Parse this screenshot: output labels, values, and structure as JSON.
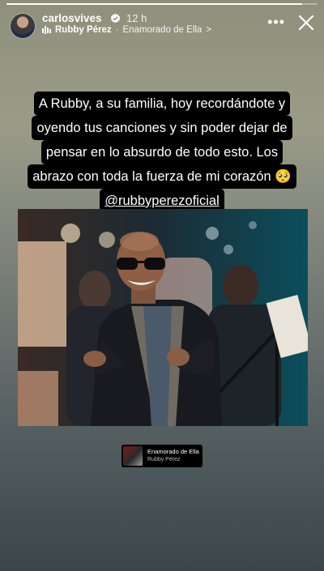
{
  "progress": {
    "fraction": 0.95
  },
  "header": {
    "username": "carlosvives",
    "time": "12 h",
    "music": {
      "artist": "Rubby Pérez",
      "separator": "·",
      "song": "Enamorado de Ella",
      "chevron": ">"
    },
    "icons": {
      "avatar": "avatar",
      "verified": "verified-badge-icon",
      "music": "music-bars-icon",
      "more": "more-icon",
      "close": "close-icon"
    }
  },
  "caption": {
    "lines": [
      "A Rubby, a su familia, hoy recordándote y",
      "oyendo tus canciones y sin poder dejar de",
      "pensar en lo absurdo de todo esto. Los",
      "abrazo con toda la fuerza de mi corazón 🥺"
    ],
    "mention": "@rubbyperezoficial"
  },
  "sticker": {
    "title": "Enamorado de Ella",
    "artist": "Rubby Pérez"
  }
}
